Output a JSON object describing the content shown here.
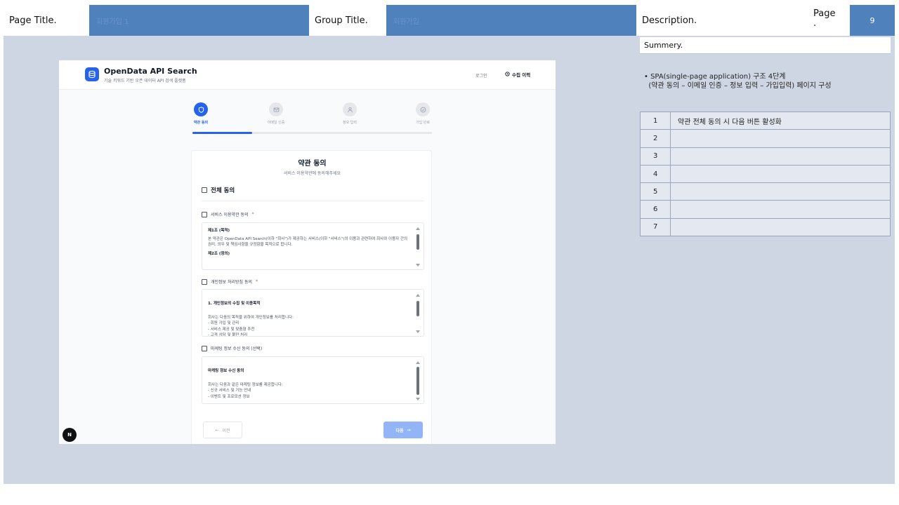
{
  "header": {
    "page_title_label": "Page Title.",
    "page_title_value": "회원가입 1",
    "group_title_label": "Group Title.",
    "group_title_value": "회원가입",
    "description_label": "Description.",
    "page_label": "Page\n.",
    "page_number": "9"
  },
  "description": {
    "summary_label": "Summery.",
    "text": "• SPA(single-page application) 구조 4단계\n  (약관 동의 – 이메일 인증 – 정보 입력 – 가입입력) 페이지 구성",
    "rows": [
      {
        "num": "1",
        "text": "약관 전체 동의 시 다음 버튼 활성화"
      },
      {
        "num": "2",
        "text": ""
      },
      {
        "num": "3",
        "text": ""
      },
      {
        "num": "4",
        "text": ""
      },
      {
        "num": "5",
        "text": ""
      },
      {
        "num": "6",
        "text": ""
      },
      {
        "num": "7",
        "text": ""
      }
    ]
  },
  "app": {
    "name": "OpenData API Search",
    "subtitle": "기술 키워드 기반 오픈 데이터 API 검색 플랫폼",
    "login": "로그인",
    "history": "수집 이력",
    "steps": [
      {
        "label": "약관 동의",
        "icon": "shield-icon",
        "active": true
      },
      {
        "label": "이메일 인증",
        "icon": "mail-icon",
        "active": false
      },
      {
        "label": "정보 입력",
        "icon": "user-icon",
        "active": false
      },
      {
        "label": "가입 완료",
        "icon": "check-circle-icon",
        "active": false
      }
    ],
    "progress": 0.25,
    "card": {
      "title": "약관 동의",
      "subtitle": "서비스 이용약관에 동의해주세요",
      "all_agree": "전체 동의",
      "sections": [
        {
          "label": "서비스 이용약관 동의",
          "required": "*",
          "heading": "제1조 (목적)",
          "body": "본 약관은 OpenData API Search(이하 \"회사\")가 제공하는 서비스(이하 \"서비스\")의 이용과 관련하여 회사와 이용자 간의 권리, 의무 및 책임사항을 규정함을 목적으로 합니다.",
          "extra": "제2조 (정의)"
        },
        {
          "label": "개인정보 처리방침 동의",
          "required": "*",
          "heading": "1. 개인정보의 수집 및 이용목적",
          "body": "회사는 다음의 목적을 위하여 개인정보를 처리합니다:\n- 회원 가입 및 관리\n- 서비스 제공 및 맞춤형 추천\n- 고객 상담 및 불만 처리",
          "extra": ""
        },
        {
          "label": "마케팅 정보 수신 동의 (선택)",
          "required": "",
          "heading": "마케팅 정보 수신 동의",
          "body": "회사는 다음과 같은 마케팅 정보를 제공합니다:\n- 신규 서비스 및 기능 안내\n- 이벤트 및 프로모션 정보",
          "extra": ""
        }
      ],
      "prev": "이전",
      "next": "다음"
    },
    "badge": "N"
  },
  "colors": {
    "accent": "#2563eb",
    "header_blue": "#4f81bd",
    "frame_bg": "#cfd6e3"
  }
}
